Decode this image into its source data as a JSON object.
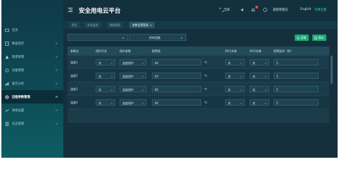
{
  "header": {
    "title": "安全用电云平台",
    "fullscreen_label": "全屏",
    "user_name": "超级管理员",
    "language": "English",
    "theme_label": "切换主题"
  },
  "sidebar": {
    "items": [
      {
        "label": "首页",
        "icon": "home-icon"
      },
      {
        "label": "数据监控",
        "icon": "monitor-icon"
      },
      {
        "label": "隐患管理",
        "icon": "warning-icon"
      },
      {
        "label": "设备管理",
        "icon": "device-icon"
      },
      {
        "label": "报告分析",
        "icon": "chart-icon"
      },
      {
        "label": "远程参数管理",
        "icon": "settings-icon"
      },
      {
        "label": "系统设置",
        "icon": "system-icon"
      },
      {
        "label": "日志管理",
        "icon": "log-icon"
      }
    ],
    "active_index": 5
  },
  "tabs": [
    {
      "label": "首页"
    },
    {
      "label": "实时监测"
    },
    {
      "label": "数据报表"
    },
    {
      "label": "参数设置管理",
      "active": true
    }
  ],
  "toolbar": {
    "device_select": "",
    "channel_select": "所有回路",
    "read_button": "读取",
    "save_button": "保存"
  },
  "table": {
    "columns": [
      "参数名",
      "保护开关",
      "保护参数",
      "报警值",
      "DO1关联",
      "DO2关联",
      "报警延时（秒）"
    ],
    "rows": [
      {
        "name": "温度1",
        "enable": "关",
        "mode": "温度保护",
        "value": "60",
        "unit": "℃",
        "do1": "关",
        "do2": "关",
        "delay": "5"
      },
      {
        "name": "温度2",
        "enable": "关",
        "mode": "温度保护",
        "value": "60",
        "unit": "℃",
        "do1": "关",
        "do2": "关",
        "delay": "5"
      },
      {
        "name": "温度3",
        "enable": "关",
        "mode": "温度保护",
        "value": "60",
        "unit": "℃",
        "do1": "关",
        "do2": "关",
        "delay": "5"
      },
      {
        "name": "温度4",
        "enable": "关",
        "mode": "温度保护",
        "value": "60",
        "unit": "℃",
        "do1": "关",
        "do2": "关",
        "delay": "5"
      },
      {
        "name": "",
        "enable": "",
        "mode": "",
        "value": "",
        "unit": "",
        "do1": "",
        "do2": "",
        "delay": ""
      }
    ]
  },
  "colors": {
    "sidebar_top": "#0f3a48",
    "sidebar_bottom": "#0e5d63",
    "content_bg": "#15303d",
    "accent_green": "#1aa876",
    "badge_red": "#e24b4b"
  }
}
